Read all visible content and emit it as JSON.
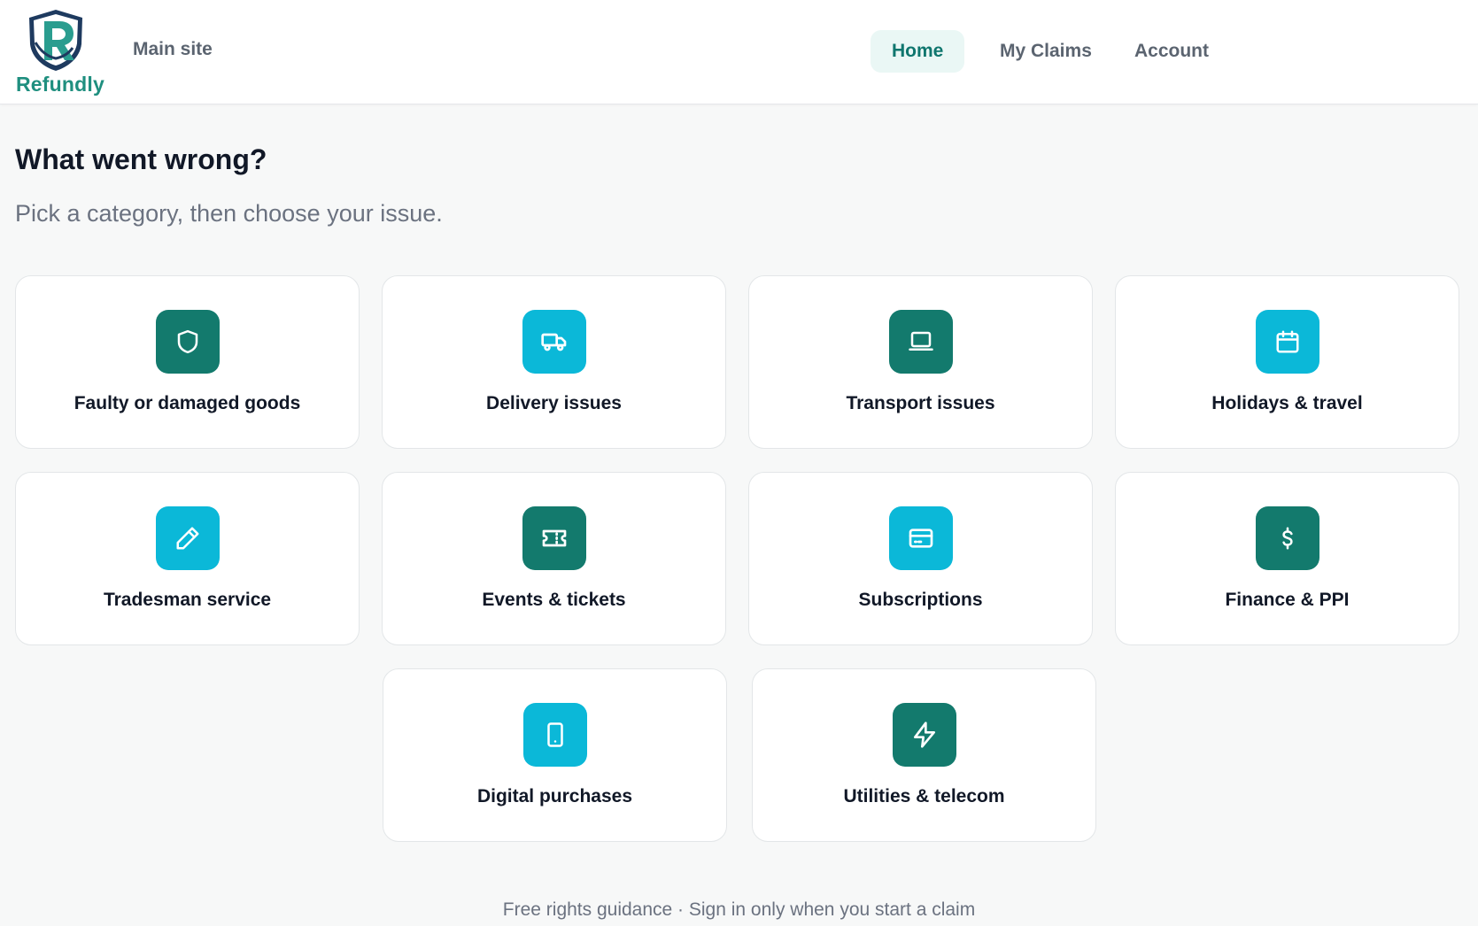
{
  "brand": {
    "name": "Refundly",
    "main_site_link": "Main site"
  },
  "nav": {
    "items": [
      {
        "label": "Home",
        "active": true
      },
      {
        "label": "My Claims",
        "active": false
      },
      {
        "label": "Account",
        "active": false
      }
    ]
  },
  "page": {
    "title": "What went wrong?",
    "subtitle": "Pick a category, then choose your issue."
  },
  "categories": [
    {
      "label": "Faulty or damaged goods",
      "icon": "shield-icon",
      "color": "#137a6d"
    },
    {
      "label": "Delivery issues",
      "icon": "truck-icon",
      "color": "#0bb8d8"
    },
    {
      "label": "Transport issues",
      "icon": "laptop-icon",
      "color": "#137a6d"
    },
    {
      "label": "Holidays & travel",
      "icon": "calendar-icon",
      "color": "#0bb8d8"
    },
    {
      "label": "Tradesman service",
      "icon": "pencil-icon",
      "color": "#0bb8d8"
    },
    {
      "label": "Events & tickets",
      "icon": "ticket-icon",
      "color": "#137a6d"
    },
    {
      "label": "Subscriptions",
      "icon": "credit-card-icon",
      "color": "#0bb8d8"
    },
    {
      "label": "Finance & PPI",
      "icon": "dollar-icon",
      "color": "#137a6d"
    },
    {
      "label": "Digital purchases",
      "icon": "smartphone-icon",
      "color": "#0bb8d8"
    },
    {
      "label": "Utilities & telecom",
      "icon": "lightning-icon",
      "color": "#137a6d"
    }
  ],
  "footer": {
    "note": "Free rights guidance · Sign in only when you start a claim"
  }
}
